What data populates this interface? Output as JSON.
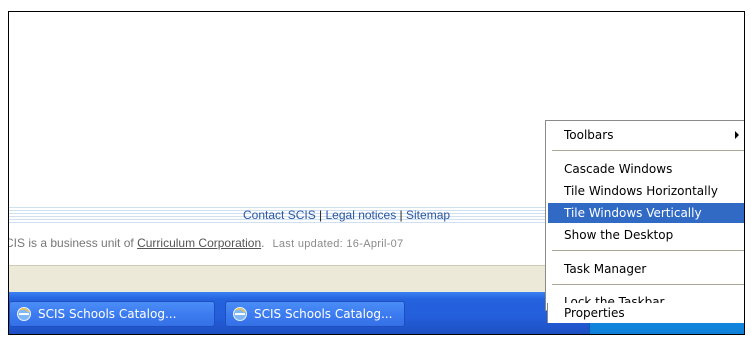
{
  "footer": {
    "link_contact": "Contact SCIS",
    "link_legal": "Legal notices",
    "link_sitemap": "Sitemap",
    "separator": " | ",
    "note_prefix": "CIS is a business unit of ",
    "note_link": "Curriculum Corporation",
    "note_suffix": ".",
    "last_updated": "Last updated: 16-April-07"
  },
  "taskbar": {
    "buttons": [
      {
        "label": "SCIS Schools Catalog...",
        "icon": "internet-explorer-icon"
      },
      {
        "label": "SCIS Schools Catalog...",
        "icon": "internet-explorer-icon"
      }
    ]
  },
  "context_menu": {
    "items": [
      {
        "label": "Toolbars",
        "submenu": true
      },
      {
        "label": "Cascade Windows"
      },
      {
        "label": "Tile Windows Horizontally"
      },
      {
        "label": "Tile Windows Vertically",
        "highlighted": true
      },
      {
        "label": "Show the Desktop"
      },
      {
        "label": "Task Manager"
      },
      {
        "label": "Lock the Taskbar"
      },
      {
        "label": "Properties"
      }
    ]
  },
  "colors": {
    "taskbar_blue": "#245edb",
    "menu_highlight": "#316ac5",
    "link_blue": "#2b56a0"
  }
}
